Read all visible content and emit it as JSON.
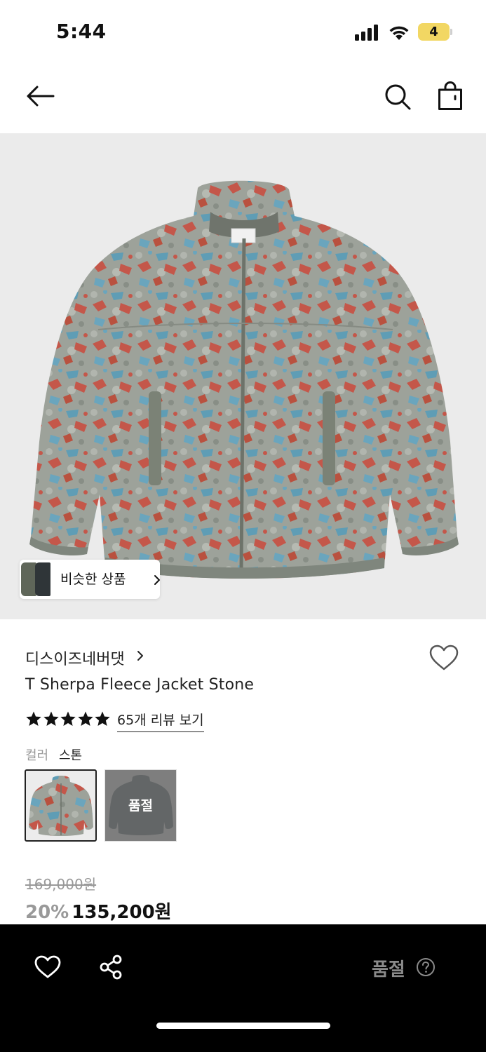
{
  "status_bar": {
    "time": "5:44",
    "battery_level": "4",
    "battery_color": "#f2d763"
  },
  "nav": {
    "back_icon": "arrow-left-icon",
    "search_icon": "search-icon",
    "bag_icon": "shopping-bag-icon"
  },
  "hero": {
    "similar_products_label": "비슷한 상품",
    "background_color": "#ebebeb"
  },
  "product": {
    "brand": "디스이즈네버댓",
    "name": "T Sherpa Fleece Jacket Stone",
    "rating_stars": 5,
    "review_link": "65개 리뷰 보기",
    "color_label": "컬러",
    "color_value": "스톤",
    "swatches": [
      {
        "selected": true,
        "sold_out": false
      },
      {
        "selected": false,
        "sold_out": true,
        "sold_out_label": "품절"
      }
    ],
    "original_price": "169,000원",
    "discount": "20%",
    "sale_price": "135,200원"
  },
  "bottom_bar": {
    "wishlist_icon": "heart-icon",
    "share_icon": "share-icon",
    "status_label": "품절",
    "help_icon": "question-circle-icon"
  }
}
